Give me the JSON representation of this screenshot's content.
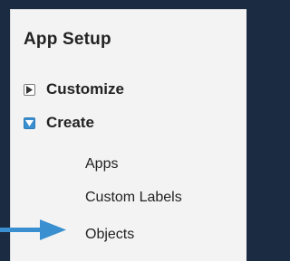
{
  "colors": {
    "backdrop": "#1b2c42",
    "panel": "#f3f3f3",
    "expanded_toggle": "#3a8fd0",
    "pointer_arrow": "#3a8fd0"
  },
  "setup": {
    "title": "App Setup",
    "nodes": [
      {
        "label": "Customize",
        "state": "collapsed",
        "icon": "expand-icon"
      },
      {
        "label": "Create",
        "state": "expanded",
        "icon": "collapse-icon",
        "children": [
          {
            "label": "Apps"
          },
          {
            "label": "Custom Labels"
          },
          {
            "label": "Objects"
          }
        ]
      }
    ]
  },
  "annotation": {
    "icon": "right-arrow-icon",
    "target": "Objects"
  }
}
